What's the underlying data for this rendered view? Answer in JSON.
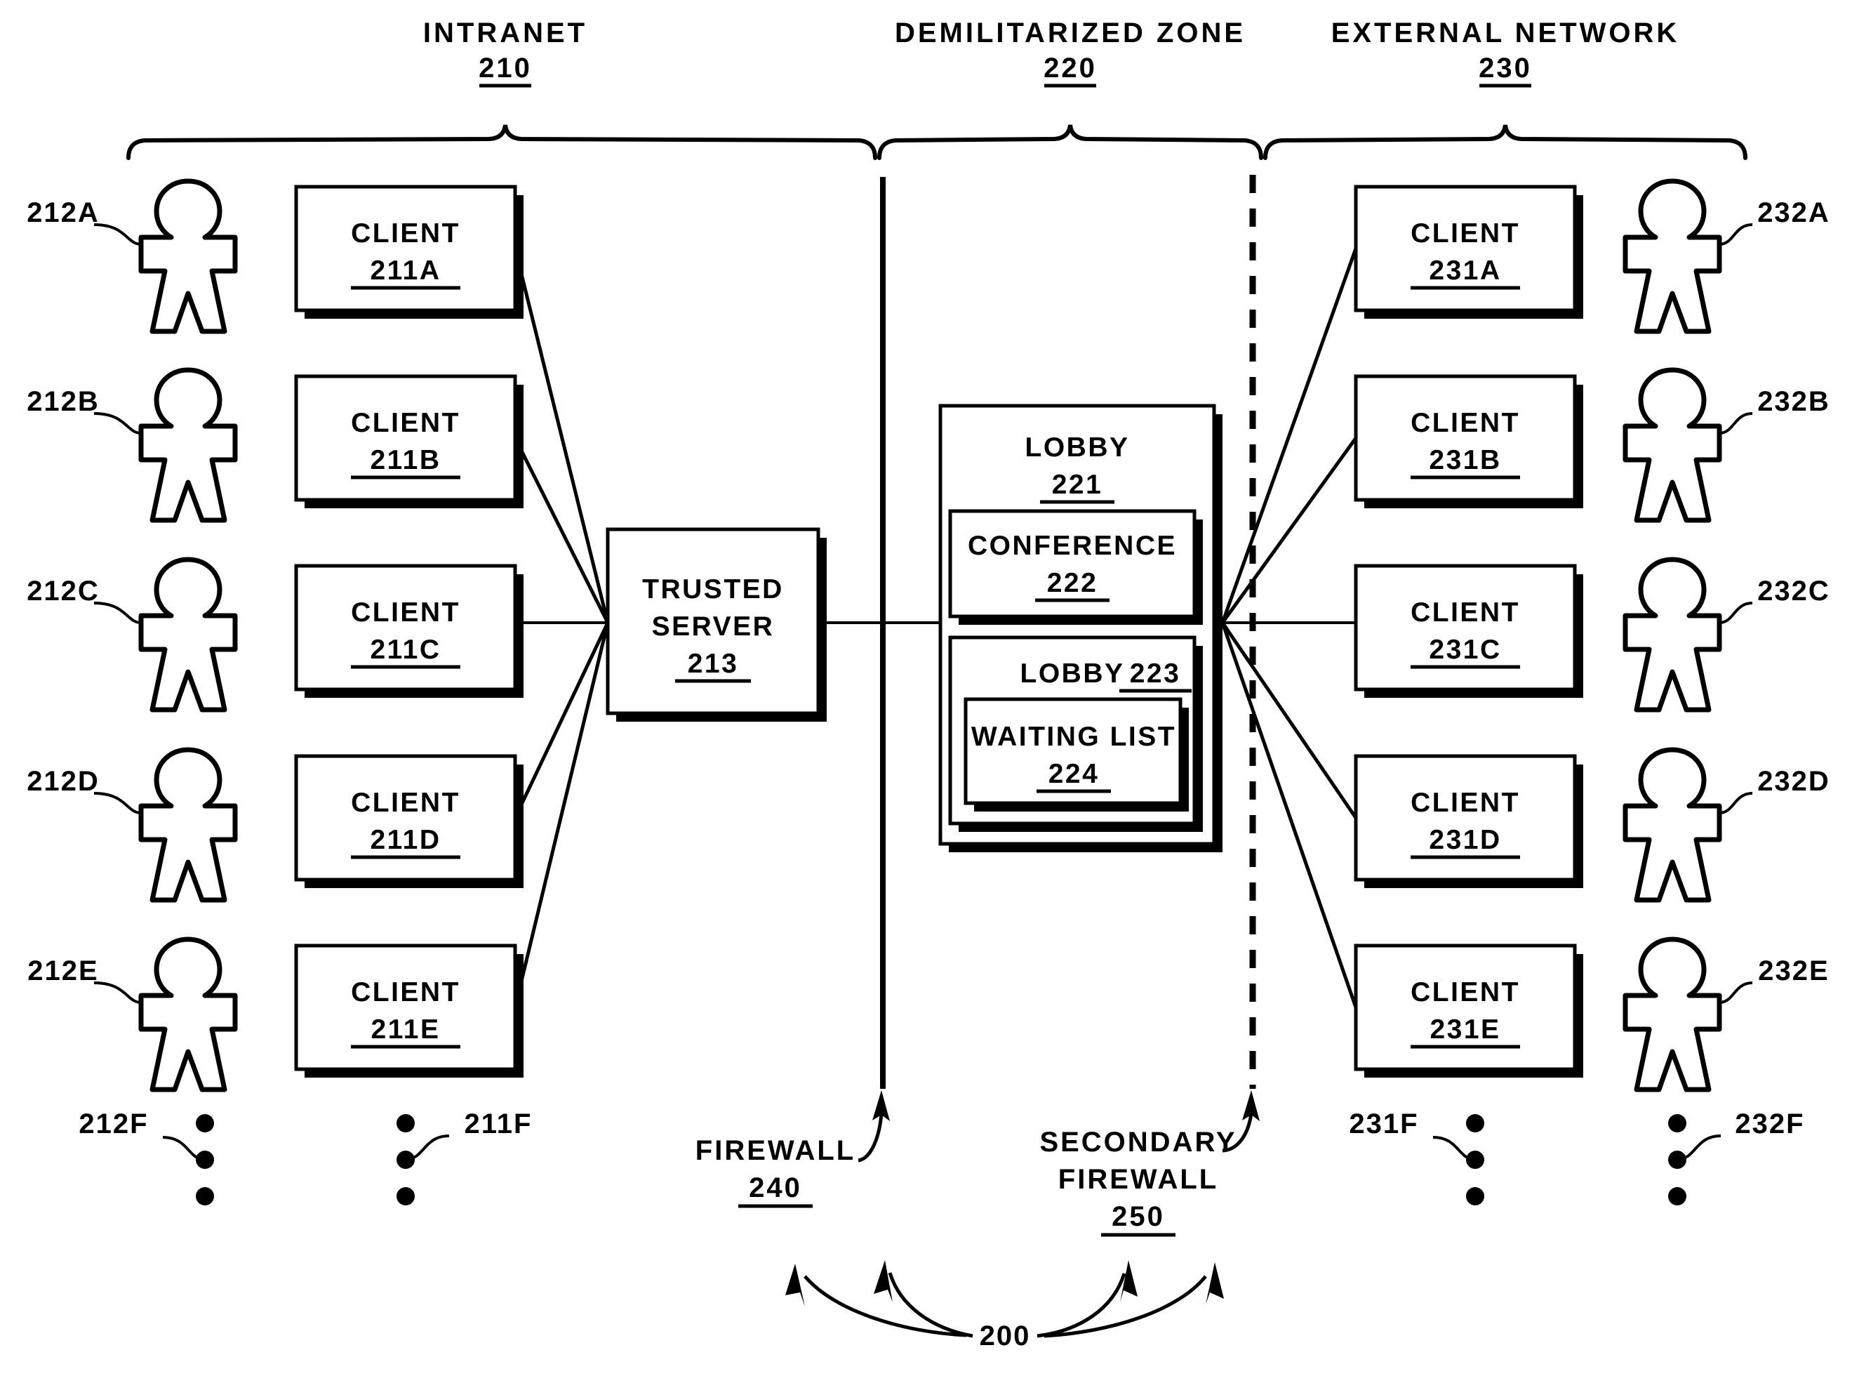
{
  "figure": {
    "reference_number": "200",
    "zones": [
      {
        "name": "zone-intranet",
        "label": "INTRANET",
        "number": "210"
      },
      {
        "name": "zone-dmz",
        "label": "DEMILITARIZED ZONE",
        "number": "220"
      },
      {
        "name": "zone-external",
        "label": "EXTERNAL NETWORK",
        "number": "230"
      }
    ],
    "intranet_users": [
      {
        "ref": "212A"
      },
      {
        "ref": "212B"
      },
      {
        "ref": "212C"
      },
      {
        "ref": "212D"
      },
      {
        "ref": "212E"
      }
    ],
    "intranet_users_more_ref": "212F",
    "intranet_clients": [
      {
        "label": "CLIENT",
        "number": "211A"
      },
      {
        "label": "CLIENT",
        "number": "211B"
      },
      {
        "label": "CLIENT",
        "number": "211C"
      },
      {
        "label": "CLIENT",
        "number": "211D"
      },
      {
        "label": "CLIENT",
        "number": "211E"
      }
    ],
    "intranet_clients_more_ref": "211F",
    "trusted_server": {
      "line1": "TRUSTED",
      "line2": "SERVER",
      "number": "213"
    },
    "dmz": {
      "lobby_outer": {
        "label": "LOBBY",
        "number": "221"
      },
      "conference": {
        "label": "CONFERENCE",
        "number": "222"
      },
      "lobby_inner": {
        "label": "LOBBY",
        "number": "223"
      },
      "waiting_list": {
        "label": "WAITING LIST",
        "number": "224"
      }
    },
    "external_clients": [
      {
        "label": "CLIENT",
        "number": "231A"
      },
      {
        "label": "CLIENT",
        "number": "231B"
      },
      {
        "label": "CLIENT",
        "number": "231C"
      },
      {
        "label": "CLIENT",
        "number": "231D"
      },
      {
        "label": "CLIENT",
        "number": "231E"
      }
    ],
    "external_clients_more_ref": "231F",
    "external_users": [
      {
        "ref": "232A"
      },
      {
        "ref": "232B"
      },
      {
        "ref": "232C"
      },
      {
        "ref": "232D"
      },
      {
        "ref": "232E"
      }
    ],
    "external_users_more_ref": "232F",
    "firewall": {
      "label_line1": "FIREWALL",
      "number": "240"
    },
    "secondary_firewall": {
      "label_line1": "SECONDARY",
      "label_line2": "FIREWALL",
      "number": "250"
    },
    "colors": {
      "ink": "#000000",
      "paper": "#ffffff"
    }
  }
}
